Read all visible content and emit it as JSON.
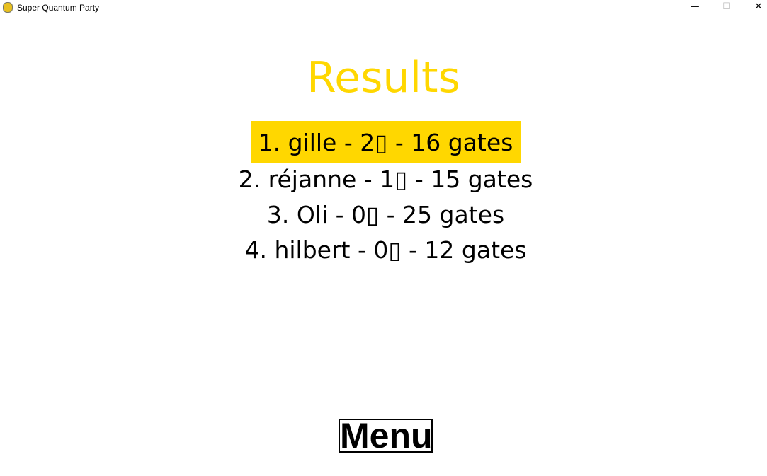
{
  "window": {
    "title": "Super Quantum Party",
    "minimize": "—",
    "maximize": "☐",
    "close": "✕"
  },
  "heading": "Results",
  "colors": {
    "accent": "#FFD700"
  },
  "results": [
    {
      "text": "1. gille - 2▯ - 16 gates",
      "highlighted": true
    },
    {
      "text": "2. réjanne - 1▯ - 15 gates"
    },
    {
      "text": "3. Oli - 0▯ - 25 gates"
    },
    {
      "text": "4. hilbert - 0▯ - 12 gates"
    }
  ],
  "menu_label": "Menu"
}
